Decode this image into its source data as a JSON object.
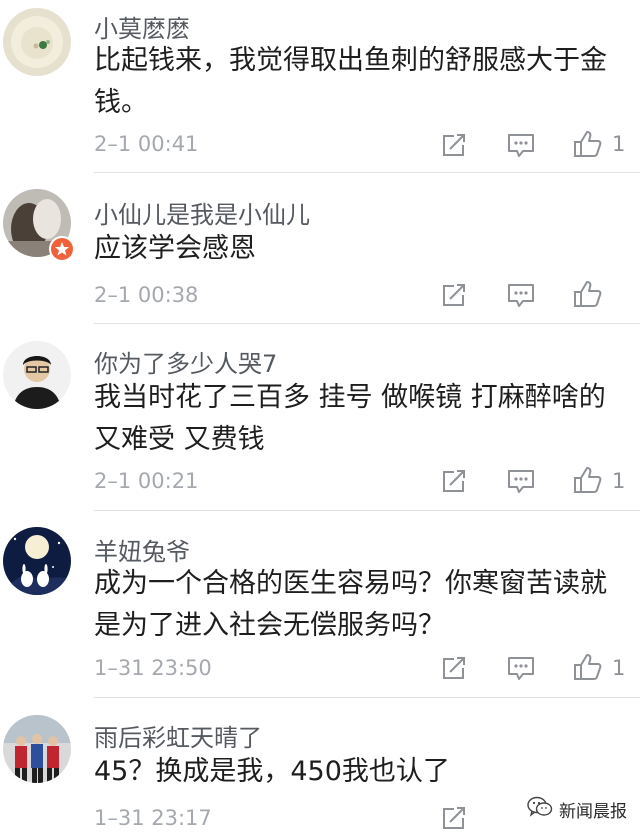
{
  "comments": [
    {
      "user": "小莫麽麽",
      "text": "比起钱来，我觉得取出鱼刺的舒服感大于金钱。",
      "time": "2–1 00:41",
      "likes": "1"
    },
    {
      "user": "小仙儿是我是小仙儿",
      "text": "应该学会感恩",
      "time": "2–1 00:38",
      "likes": ""
    },
    {
      "user": "你为了多少人哭7",
      "text_lines": [
        "我当时花了三百多 挂号 做喉镜 打麻醉啥的",
        "又难受 又费钱"
      ],
      "time": "2–1 00:21",
      "likes": "1"
    },
    {
      "user": "羊妞兔爷",
      "text": "成为一个合格的医生容易吗？你寒窗苦读就是为了进入社会无偿服务吗？",
      "time": "1–31 23:50",
      "likes": "1"
    },
    {
      "user": "雨后彩虹天晴了",
      "text": "45？换成是我，450我也认了",
      "time": "1–31 23:17",
      "likes": ""
    }
  ],
  "icons": {
    "share": "share-icon",
    "reply": "reply-icon",
    "like": "thumbs-up-icon"
  },
  "watermark": {
    "text": "新闻晨报",
    "icon": "wechat-icon"
  },
  "colors": {
    "username": "#555a60",
    "text": "#1e1e1e",
    "time": "#a5a9ae",
    "icon": "#8e9297",
    "divider": "#e3e3e3"
  }
}
